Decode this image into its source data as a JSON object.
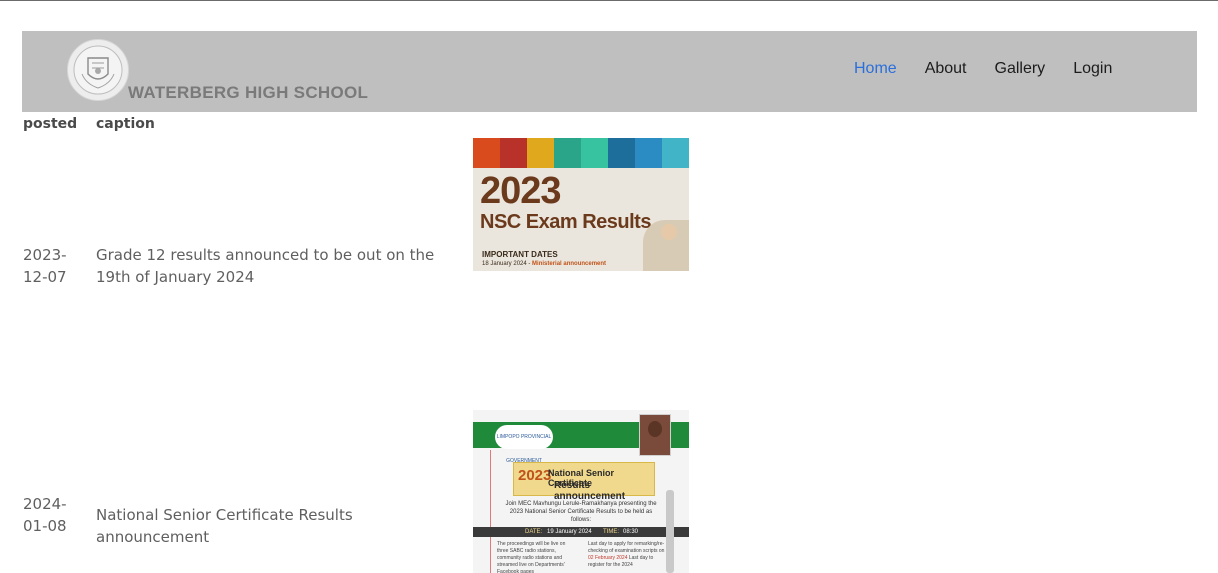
{
  "header": {
    "school_name": "WATERBERG HIGH SCHOOL",
    "nav": [
      "Home",
      "About",
      "Gallery",
      "Login"
    ],
    "active_nav": "Home"
  },
  "table": {
    "columns": [
      "posted",
      "caption"
    ],
    "rows": [
      {
        "posted": "2023-12-07",
        "caption": "Grade 12 results announced to be out on the 19th of January 2024",
        "image": {
          "year": "2023",
          "title": "NSC Exam Results",
          "dates_heading": "IMPORTANT DATES",
          "date_line_a": "18 January 2024 - ",
          "date_line_b": "Ministerial announcement"
        }
      },
      {
        "posted": "2024-01-08",
        "caption": "National Senior Certificate Results announcement",
        "image": {
          "province": "LIMPOPO PROVINCIAL GOVERNMENT",
          "year": "2023",
          "title_a": "National Senior Certificate",
          "title_b": "Results announcement",
          "body": "Join MEC Mavhungu Lerule-Ramakhanya presenting the 2023 National Senior Certificate Results to be held as follows:",
          "date_label": "DATE:",
          "date_value": "19 January 2024",
          "time_label": "TIME:",
          "time_value": "08:30",
          "col_left": "The proceedings will be live on three SABC radio stations, community radio stations and streamed live on Departments' Facebook pages",
          "col_right_a": "Last day to apply for remarking/re-checking of examination scripts on",
          "col_right_b": "02 February 2024",
          "col_right_c": "Last day to register for the 2024"
        }
      }
    ]
  },
  "colors": {
    "navbar_bg": "#bfbfbf",
    "active_nav": "#2a6fdb",
    "nav_text": "#1c1c1c",
    "body_text": "#5f5f5f",
    "poster_brown": "#6b3a1c",
    "poster_green": "#1f8a3a",
    "poster_gold": "#f0d98c"
  },
  "icons": {
    "logo": "school-crest-icon"
  }
}
